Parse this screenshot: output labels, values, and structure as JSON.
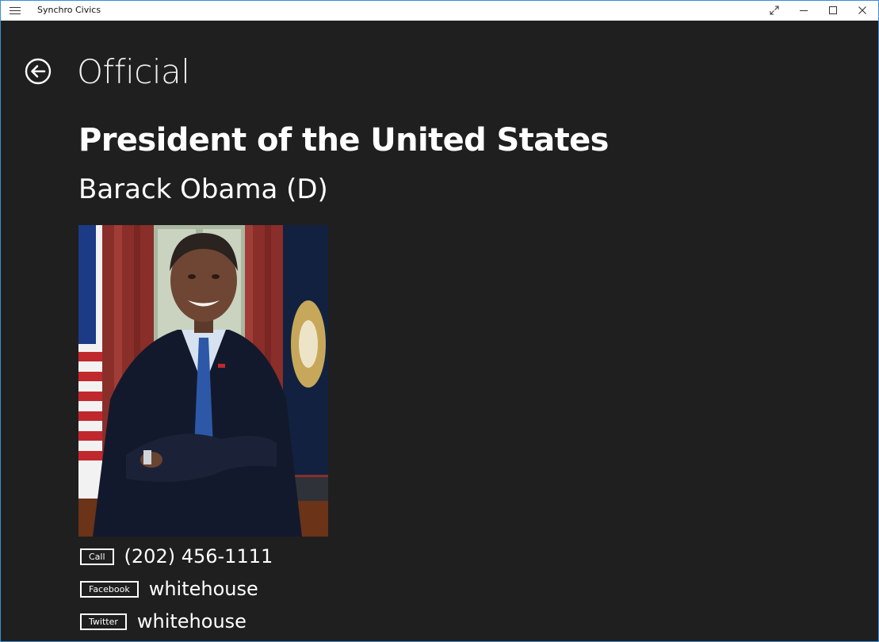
{
  "window": {
    "title": "Synchro Civics"
  },
  "page": {
    "title": "Official"
  },
  "official": {
    "office": "President of the United States",
    "name": "Barack Obama (D)"
  },
  "contacts": [
    {
      "button_label": "Call",
      "value": "(202) 456-1111",
      "icon": "phone"
    },
    {
      "button_label": "Facebook",
      "value": "whitehouse",
      "icon": "facebook"
    },
    {
      "button_label": "Twitter",
      "value": "whitehouse",
      "icon": "twitter"
    }
  ],
  "colors": {
    "background": "#1f1f1f",
    "titlebar": "#ffffff",
    "text": "#ffffff",
    "window_border": "#3c8fd6"
  }
}
